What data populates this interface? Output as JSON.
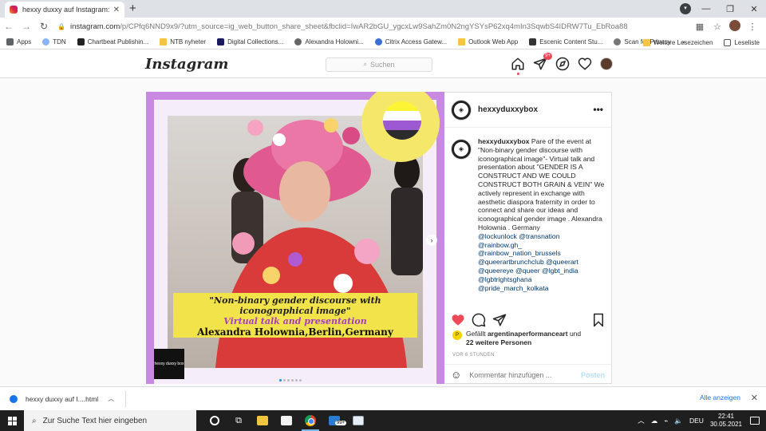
{
  "browser": {
    "tab_title": "hexxy duxxy auf Instagram: „Pare",
    "url_host": "instagram.com",
    "url_path": "/p/CPfq6NND9x9/?utm_source=ig_web_button_share_sheet&fbclid=IwAR2bGU_ygcxLw9SahZm0N2ngYSYsP62xq4mIn3SqwbS4IDRW7Tu_EbRoa88",
    "bookmarks": [
      "Apps",
      "TDN",
      "Chartbeat Publishin...",
      "NTB nyheter",
      "Digital Collections...",
      "Alexandra Holowni...",
      "Citrix Access Gatew...",
      "Outlook Web App",
      "Escenic Content Stu...",
      "Scan for Privacy"
    ],
    "bookmarks_overflow": "»",
    "bookmarks_right": [
      "Weitere Lesezeichen",
      "Leseliste"
    ]
  },
  "instagram": {
    "logo": "Instagram",
    "search_placeholder": "Suchen",
    "activity_badge": "9+",
    "post": {
      "username": "hexxyduxxybox",
      "caption_main": "Pare of the event at \"Non-binary gender discourse with iconographical image\"- Virtual talk and presentation about \"GENDER IS A CONSTRUCT AND WE COULD CONSTRUCT BOTH GRAIN & VEIN\" We actively represent in exchange with aesthetic diaspora fraternity in order to connect and share our ideas and iconographical gender image . Alexandra Holownia . Germany",
      "tags": [
        "@lockunlock @transnation",
        "@rainbow.gh_",
        "@rainbow_nation_brussels",
        "@queerartbrunchclub @queerart",
        "@queereye @queer @lgbt_india",
        "@lgbtrightsghana",
        "@pride_march_kolkata"
      ],
      "likes_prefix": "Gefällt",
      "likes_user": "argentinaperformanceart",
      "likes_and": "und",
      "likes_others": "22 weitere Personen",
      "posted": "VOR 6 STUNDEN",
      "comment_placeholder": "Kommentar hinzufügen ...",
      "post_button": "Posten",
      "image_caption": {
        "line1": "\"Non-binary gender discourse with iconographical image\"",
        "line2": "Virtual talk and presentation",
        "line3": "Alexandra Holownia,Berlin,Germany"
      },
      "image_logo": "hexxy duxxy box"
    }
  },
  "downloads": {
    "file": "hexxy duxxy auf I....html",
    "show_all": "Alle anzeigen"
  },
  "taskbar": {
    "search_placeholder": "Zur Suche Text hier eingeben",
    "mail_badge": "99+",
    "lang": "DEU",
    "time": "22:41",
    "date": "30.05.2021"
  },
  "colors": {
    "accent_like": "#ed4956",
    "link": "#00376b",
    "post_frame": "#c78ae0",
    "caption_yellow": "#f2e34a"
  }
}
